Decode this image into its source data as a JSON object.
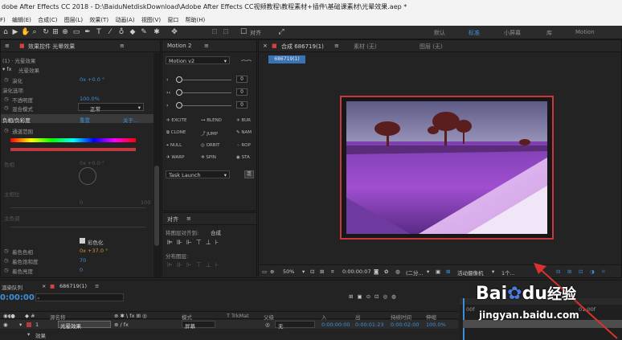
{
  "title": "dobe After Effects CC 2018 - D:\\BaiduNetdiskDownload\\Adobe After Effects CC视频教程\\教程素材+插件\\基础课素材\\光晕效果.aep *",
  "menu": [
    "F)",
    "编辑(E)",
    "合成(C)",
    "图层(L)",
    "效果(T)",
    "动画(A)",
    "视图(V)",
    "窗口",
    "帮助(H)"
  ],
  "toolbar": {
    "align_label": "对齐",
    "workspaces": [
      "默认",
      "标准",
      "小屏幕",
      "库",
      "Motion"
    ]
  },
  "effects_panel": {
    "tab": "效果控件 光晕效果",
    "layer": "(1) · 光晕效果",
    "fx_name": "光晕效果",
    "rows": [
      {
        "label": "演化",
        "value": "0x +0.0 °"
      },
      {
        "label": "演化选项",
        "value": ""
      },
      {
        "label": "不透明度",
        "value": "100.0%"
      },
      {
        "label": "混合模式",
        "value": "正常"
      },
      {
        "label": "负相/负彩度",
        "value": "重置",
        "extra": "关于..."
      },
      {
        "label": "通道范围",
        "value": ""
      },
      {
        "label": "色相",
        "value": "0x +0.0 °"
      },
      {
        "label": "主相位",
        "value": ""
      },
      {
        "label": "主色调",
        "value": ""
      },
      {
        "label": "彩色化",
        "value": ""
      },
      {
        "label": "着色色相",
        "value": "0x +37.0 °"
      },
      {
        "label": "着色饱和度",
        "value": "70"
      },
      {
        "label": "着色亮度",
        "value": "0"
      }
    ],
    "scale_left": "0",
    "scale_right": "100"
  },
  "motion_panel": {
    "tab": "Motion 2",
    "version": "Motion v2",
    "values": [
      "0",
      "0",
      "0"
    ],
    "buttons": [
      [
        "EXCITE",
        "BLEND",
        "BUR"
      ],
      [
        "CLONE",
        "JUMP",
        "NAM"
      ],
      [
        "NULL",
        "ORBIT",
        "ROP"
      ],
      [
        "WARP",
        "SPIN",
        "STA"
      ]
    ],
    "task_launch": "Task Launch",
    "run_label": "连"
  },
  "align_panel": {
    "tab": "对齐",
    "align_to_label": "将图层对齐到:",
    "align_to_value": "合成",
    "distribute_label": "分布图层:"
  },
  "comp_panel": {
    "tabs": [
      "合成 686719(1)",
      "素材 (无)",
      "图层 (无)"
    ],
    "breadcrumb": "686719(1)",
    "zoom": "50%",
    "timecode": "0:00:00:07",
    "quality": "(二分...",
    "camera": "活动摄像机",
    "view": "1个..."
  },
  "timeline": {
    "render_tab": "渲染队列",
    "comp_tab": "686719(1)",
    "timecode": "0:00:00",
    "columns": {
      "source_name": "源名称",
      "mode": "模式",
      "trkmat": "T TrkMat",
      "parent": "父级",
      "in": "入",
      "out": "出",
      "duration": "持续时间",
      "stretch": "伸缩"
    },
    "layer": {
      "index": "1",
      "name": "光晕效果",
      "mode": "屏幕",
      "parent": "无",
      "in": "0:00:00:00",
      "out": "0:00:01:23",
      "duration": "0:00:02:00",
      "stretch": "100.0%"
    },
    "effects_label": "效果",
    "ruler": [
      "00f",
      "01:00f"
    ]
  },
  "watermark": {
    "brand": "Bai",
    "brand2": "du",
    "suffix": "经验",
    "url": "jingyan.baidu.com"
  },
  "colors": {
    "accent": "#3f8fd8",
    "highlight": "#c7373b"
  }
}
